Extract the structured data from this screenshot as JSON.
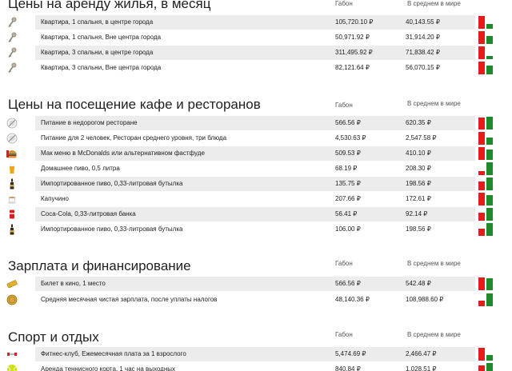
{
  "colors": {
    "local_bar": "#e21d1d",
    "world_bar": "#1f8a2b",
    "band": "#ececec"
  },
  "sections": [
    {
      "title": "Цены на аренду жилья, в месяц",
      "col_local": "Габон",
      "col_world": "В среднем в мире",
      "rows": [
        {
          "icon": "key-icon",
          "label": "Квартира, 1 спальня, в центре города",
          "local": "105,720.10 ₽",
          "world": "40,143.55 ₽",
          "local_num": 105720.1,
          "world_num": 40143.55
        },
        {
          "icon": "key-icon",
          "label": "Квартира, 1 спальня, Вне центра города",
          "local": "50,971.92 ₽",
          "world": "31,914.20 ₽",
          "local_num": 50971.92,
          "world_num": 31914.2
        },
        {
          "icon": "key-icon",
          "label": "Квартира, 3 спальни, в центре города",
          "local": "311,495.92 ₽",
          "world": "71,838.42 ₽",
          "local_num": 311495.92,
          "world_num": 71838.42
        },
        {
          "icon": "key-icon",
          "label": "Квартира, 3 спальни, Вне центра города",
          "local": "82,121.64 ₽",
          "world": "56,070.15 ₽",
          "local_num": 82121.64,
          "world_num": 56070.15
        }
      ]
    },
    {
      "title": "Цены на посещение кафе и ресторанов",
      "col_local": "Габон",
      "col_world": "В среднем в мире",
      "rows": [
        {
          "icon": "plate-icon",
          "label": "Питание в недорогом ресторане",
          "local": "566.56 ₽",
          "world": "620.35 ₽",
          "local_num": 566.56,
          "world_num": 620.35
        },
        {
          "icon": "plate-icon",
          "label": "Питание для 2 человек, Ресторан среднего уровня, три блюда",
          "local": "4,530.63 ₽",
          "world": "2,547.58 ₽",
          "local_num": 4530.63,
          "world_num": 2547.58
        },
        {
          "icon": "burger-icon",
          "label": "Мак меню в McDonalds или альтернативном фастфуде",
          "local": "509.53 ₽",
          "world": "410.10 ₽",
          "local_num": 509.53,
          "world_num": 410.1
        },
        {
          "icon": "beer-glass-icon",
          "label": "Домашнее пиво, 0,5 литра",
          "local": "68.19 ₽",
          "world": "208.30 ₽",
          "local_num": 68.19,
          "world_num": 208.3
        },
        {
          "icon": "beer-bottle-icon",
          "label": "Импортированное пиво, 0,33-литровая бутылка",
          "local": "135.75 ₽",
          "world": "198.56 ₽",
          "local_num": 135.75,
          "world_num": 198.56
        },
        {
          "icon": "coffee-cup-icon",
          "label": "Капучино",
          "local": "207.66 ₽",
          "world": "172.61 ₽",
          "local_num": 207.66,
          "world_num": 172.61
        },
        {
          "icon": "soda-can-icon",
          "label": "Coca-Cola, 0,33-литровая банка",
          "local": "56.41 ₽",
          "world": "92.14 ₽",
          "local_num": 56.41,
          "world_num": 92.14
        },
        {
          "icon": "beer-bottle-icon",
          "label": "Импортированное пиво, 0,33-литровая бутылка",
          "local": "106.00 ₽",
          "world": "198.56 ₽",
          "local_num": 106.0,
          "world_num": 198.56
        }
      ]
    },
    {
      "title": "Зарплата и финансирование",
      "col_local": "Габон",
      "col_world": "В среднем в мире",
      "rows": [
        {
          "icon": "ticket-icon",
          "label": "Билет в кино, 1 место",
          "local": "566.56 ₽",
          "world": "542.48 ₽",
          "local_num": 566.56,
          "world_num": 542.48
        },
        {
          "icon": "coin-icon",
          "label": "Средняя месячная чистая зарплата, после уплаты налогов",
          "local": "48,140.36 ₽",
          "world": "108,988.60 ₽",
          "local_num": 48140.36,
          "world_num": 108988.6
        }
      ]
    },
    {
      "title": "Спорт и отдых",
      "col_local": "Габон",
      "col_world": "В среднем в мире",
      "rows": [
        {
          "icon": "dumbbell-icon",
          "label": "Фитнес-клуб, Ежемесячная плата за 1 взрослого",
          "local": "5,474.69 ₽",
          "world": "2,466.47 ₽",
          "local_num": 5474.69,
          "world_num": 2466.47
        },
        {
          "icon": "tennis-ball-icon",
          "label": "Аренда теннисного корта, 1 час на выходных",
          "local": "840.84 ₽",
          "world": "1,028.51 ₽",
          "local_num": 840.84,
          "world_num": 1028.51
        }
      ]
    }
  ]
}
